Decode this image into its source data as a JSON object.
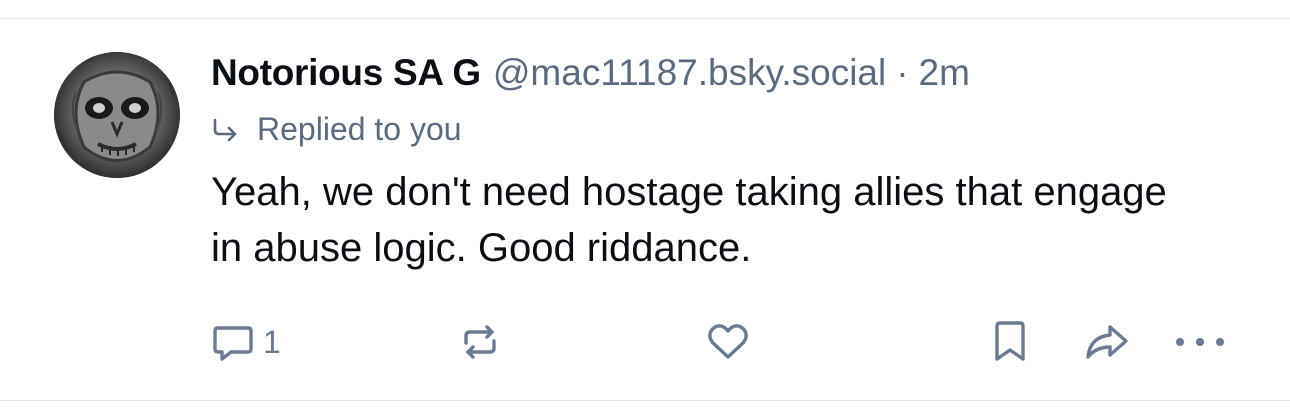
{
  "post": {
    "author": {
      "display_name": "Notorious SA G",
      "handle": "@mac11187.bsky.social",
      "avatar_icon": "avatar-image"
    },
    "separator": "·",
    "time": "2m",
    "reply_context": {
      "label": "Replied to you",
      "icon": "reply-arrow-icon"
    },
    "text": "Yeah, we don't need hostage taking allies that engage in abuse logic. Good riddance.",
    "actions": {
      "reply": {
        "icon": "comment-icon",
        "count": "1"
      },
      "repost": {
        "icon": "repost-icon"
      },
      "like": {
        "icon": "heart-icon"
      },
      "bookmark": {
        "icon": "bookmark-icon"
      },
      "share": {
        "icon": "share-icon"
      },
      "more": {
        "icon": "more-icon"
      }
    }
  },
  "colors": {
    "text_primary": "#0b0f14",
    "text_secondary": "#5b6a7d",
    "icon": "#6b7a90",
    "divider": "#e6e9ee",
    "background": "#ffffff"
  }
}
